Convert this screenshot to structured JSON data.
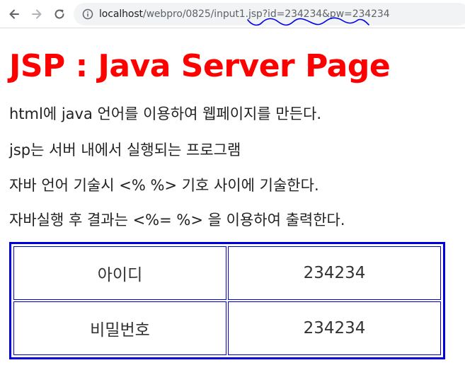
{
  "browser": {
    "url_host": "localhost",
    "url_path": "/webpro/0825/input1.jsp?id=234234&pw=234234"
  },
  "page": {
    "title": "JSP : Java Server Page",
    "lines": [
      "html에 java 언어를 이용하여 웹페이지를 만든다.",
      "jsp는 서버 내에서 실행되는 프로그램",
      "자바 언어 기술시 <% %> 기호 사이에 기술한다.",
      "자바실행 후 결과는 <%= %> 을 이용하여 출력한다."
    ]
  },
  "table": {
    "rows": [
      {
        "label": "아이디",
        "value": "234234"
      },
      {
        "label": "비밀번호",
        "value": "234234"
      }
    ]
  },
  "colors": {
    "title": "#ff0000",
    "table_border": "#0000dd",
    "annotation": "#0000ee"
  },
  "icons": [
    "back-arrow-icon",
    "forward-arrow-icon",
    "reload-icon",
    "info-icon"
  ]
}
